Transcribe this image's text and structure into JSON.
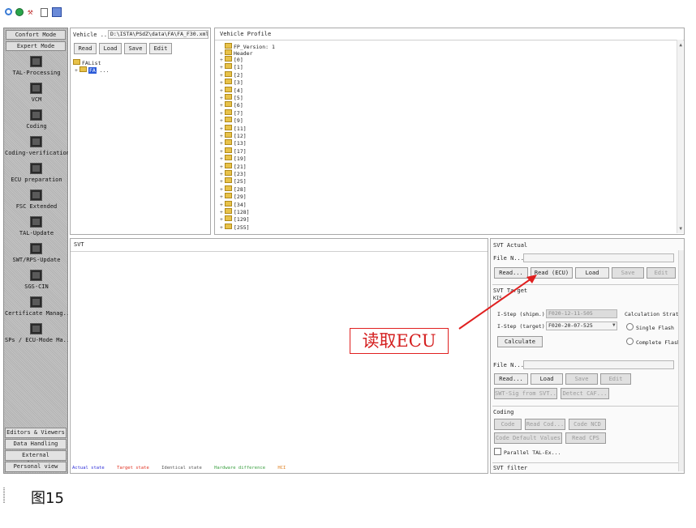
{
  "toolbar": {
    "icons": [
      "cycle-icon",
      "globe-icon",
      "tools-icon",
      "document-icon",
      "grid-icon"
    ]
  },
  "sidebar": {
    "modes": [
      "Confort Mode",
      "Expert Mode"
    ],
    "items": [
      "TAL-Processing",
      "VCM",
      "Coding",
      "Coding-verification",
      "ECU preparation",
      "FSC Extended",
      "TAL-Update",
      "SWT/RPS-Update",
      "SGS-CIN",
      "Certificate Manag...",
      "SPs / ECU-Mode Ma..."
    ],
    "bottom": [
      "Editors & Viewers",
      "Data Handling",
      "External Applicat...",
      "Personal view"
    ]
  },
  "vehicle_panel": {
    "label": "Vehicle ...",
    "path": "D:\\ISTA\\PSdZ\\data\\FA\\FA_F30.xml",
    "buttons": [
      "Read",
      "Load",
      "Save",
      "Edit"
    ],
    "tree_root": "FAList",
    "tree_child_selected": "FA",
    "tree_child_rest": "..."
  },
  "profile_panel": {
    "title": "Vehicle Profile",
    "version": "FP_Version: 1",
    "header": "Header",
    "nodes": [
      "[0]",
      "[1]",
      "[2]",
      "[3]",
      "[4]",
      "[5]",
      "[6]",
      "[7]",
      "[9]",
      "[11]",
      "[12]",
      "[13]",
      "[17]",
      "[19]",
      "[21]",
      "[23]",
      "[25]",
      "[28]",
      "[29]",
      "[34]",
      "[128]",
      "[129]",
      "[255]"
    ]
  },
  "svt_panel": {
    "title": "SVT",
    "legend": [
      "Actual state",
      "Target state",
      "Identical state",
      "Hardware difference",
      "HCI"
    ],
    "legend_colors": [
      "#2b2bd8",
      "#e03020",
      "#555555",
      "#3aa040",
      "#e08020"
    ]
  },
  "svt_actual": {
    "title": "SVT Actual",
    "file_label": "File N...",
    "buttons": [
      "Read...",
      "Read (ECU)",
      "Load",
      "Save",
      "Edit"
    ]
  },
  "svt_target": {
    "title": "SVT Target",
    "sub": "KIS",
    "istep_shipm_label": "I-Step (shipm.):",
    "istep_shipm_value": "F020-12-11-505",
    "istep_target_label": "I-Step (target):",
    "istep_target_value": "F020-20-07-525",
    "calc_label": "Calculation Strat",
    "radio_single": "Single Flash",
    "radio_complete": "Complete Flash",
    "calculate_button": "Calculate",
    "file_label": "File N...",
    "buttons2": [
      "Read...",
      "Load",
      "Save",
      "Edit"
    ],
    "buttons3": [
      "SWT-Sig from SVT...",
      "Detect CAF..."
    ]
  },
  "coding": {
    "title": "Coding",
    "buttons1": [
      "Code",
      "Read Cod...",
      "Code NCD"
    ],
    "buttons2": [
      "Code Default Values",
      "Read CPS"
    ],
    "parallel": "Parallel TAL-Ex..."
  },
  "svt_filter": {
    "title": "SVT filter"
  },
  "annotation": {
    "text": "读取ECU"
  },
  "caption": {
    "text": "图15"
  }
}
